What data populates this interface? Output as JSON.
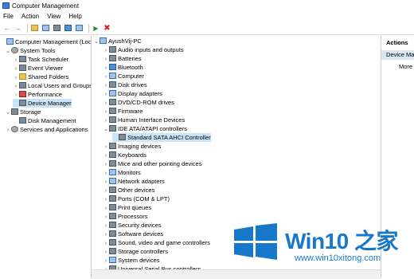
{
  "window": {
    "title": "Computer Management"
  },
  "menu": [
    "File",
    "Action",
    "View",
    "Help"
  ],
  "toolbar_icons": [
    "back-icon",
    "forward-icon",
    "up-folder-icon",
    "show-hide-tree-icon",
    "properties-icon",
    "help-icon",
    "monitor-icon",
    "scan-hardware-icon",
    "uninstall-icon"
  ],
  "left_tree": [
    {
      "label": "Computer Management (Local",
      "level": 0,
      "arrow": "",
      "icon": "pc"
    },
    {
      "label": "System Tools",
      "level": 1,
      "arrow": "v",
      "icon": "gear"
    },
    {
      "label": "Task Scheduler",
      "level": 2,
      "arrow": ">",
      "icon": "dev"
    },
    {
      "label": "Event Viewer",
      "level": 2,
      "arrow": ">",
      "icon": "dev"
    },
    {
      "label": "Shared Folders",
      "level": 2,
      "arrow": ">",
      "icon": "fold"
    },
    {
      "label": "Local Users and Groups",
      "level": 2,
      "arrow": ">",
      "icon": "dev"
    },
    {
      "label": "Performance",
      "level": 2,
      "arrow": ">",
      "icon": "red"
    },
    {
      "label": "Device Manager",
      "level": 2,
      "arrow": "",
      "icon": "dev",
      "selected": true
    },
    {
      "label": "Storage",
      "level": 1,
      "arrow": "v",
      "icon": "dev"
    },
    {
      "label": "Disk Management",
      "level": 2,
      "arrow": "",
      "icon": "dev"
    },
    {
      "label": "Services and Applications",
      "level": 1,
      "arrow": ">",
      "icon": "gear"
    }
  ],
  "device_tree": [
    {
      "label": "AyushVij-PC",
      "level": 0,
      "arrow": "v",
      "icon": "pc"
    },
    {
      "label": "Audio inputs and outputs",
      "level": 1,
      "arrow": ">",
      "icon": "dev"
    },
    {
      "label": "Batteries",
      "level": 1,
      "arrow": ">",
      "icon": "dev"
    },
    {
      "label": "Bluetooth",
      "level": 1,
      "arrow": ">",
      "icon": "blue"
    },
    {
      "label": "Computer",
      "level": 1,
      "arrow": ">",
      "icon": "pc"
    },
    {
      "label": "Disk drives",
      "level": 1,
      "arrow": ">",
      "icon": "dev"
    },
    {
      "label": "Display adapters",
      "level": 1,
      "arrow": ">",
      "icon": "pc"
    },
    {
      "label": "DVD/CD-ROM drives",
      "level": 1,
      "arrow": ">",
      "icon": "dev"
    },
    {
      "label": "Firmware",
      "level": 1,
      "arrow": ">",
      "icon": "dev"
    },
    {
      "label": "Human Interface Devices",
      "level": 1,
      "arrow": ">",
      "icon": "dev"
    },
    {
      "label": "IDE ATA/ATAPI controllers",
      "level": 1,
      "arrow": "v",
      "icon": "dev"
    },
    {
      "label": "Standard SATA AHCI Controller",
      "level": 2,
      "arrow": "",
      "icon": "dev",
      "selected": true
    },
    {
      "label": "Imaging devices",
      "level": 1,
      "arrow": ">",
      "icon": "dev"
    },
    {
      "label": "Keyboards",
      "level": 1,
      "arrow": ">",
      "icon": "dev"
    },
    {
      "label": "Mice and other pointing devices",
      "level": 1,
      "arrow": ">",
      "icon": "dev"
    },
    {
      "label": "Monitors",
      "level": 1,
      "arrow": ">",
      "icon": "pc"
    },
    {
      "label": "Network adapters",
      "level": 1,
      "arrow": ">",
      "icon": "pc"
    },
    {
      "label": "Other devices",
      "level": 1,
      "arrow": ">",
      "icon": "dev"
    },
    {
      "label": "Ports (COM & LPT)",
      "level": 1,
      "arrow": ">",
      "icon": "dev"
    },
    {
      "label": "Print queues",
      "level": 1,
      "arrow": ">",
      "icon": "dev"
    },
    {
      "label": "Processors",
      "level": 1,
      "arrow": ">",
      "icon": "dev"
    },
    {
      "label": "Security devices",
      "level": 1,
      "arrow": ">",
      "icon": "dev"
    },
    {
      "label": "Software devices",
      "level": 1,
      "arrow": ">",
      "icon": "dev"
    },
    {
      "label": "Sound, video and game controllers",
      "level": 1,
      "arrow": ">",
      "icon": "dev"
    },
    {
      "label": "Storage controllers",
      "level": 1,
      "arrow": ">",
      "icon": "dev"
    },
    {
      "label": "System devices",
      "level": 1,
      "arrow": ">",
      "icon": "pc"
    },
    {
      "label": "Universal Serial Bus controllers",
      "level": 1,
      "arrow": ">",
      "icon": "dev"
    }
  ],
  "actions": {
    "title": "Actions",
    "section": "Device Manager",
    "more": "More ..."
  },
  "watermark": {
    "title": "Win10 之家",
    "url": "www.win10xitong.com",
    "color": "#1778c9"
  }
}
